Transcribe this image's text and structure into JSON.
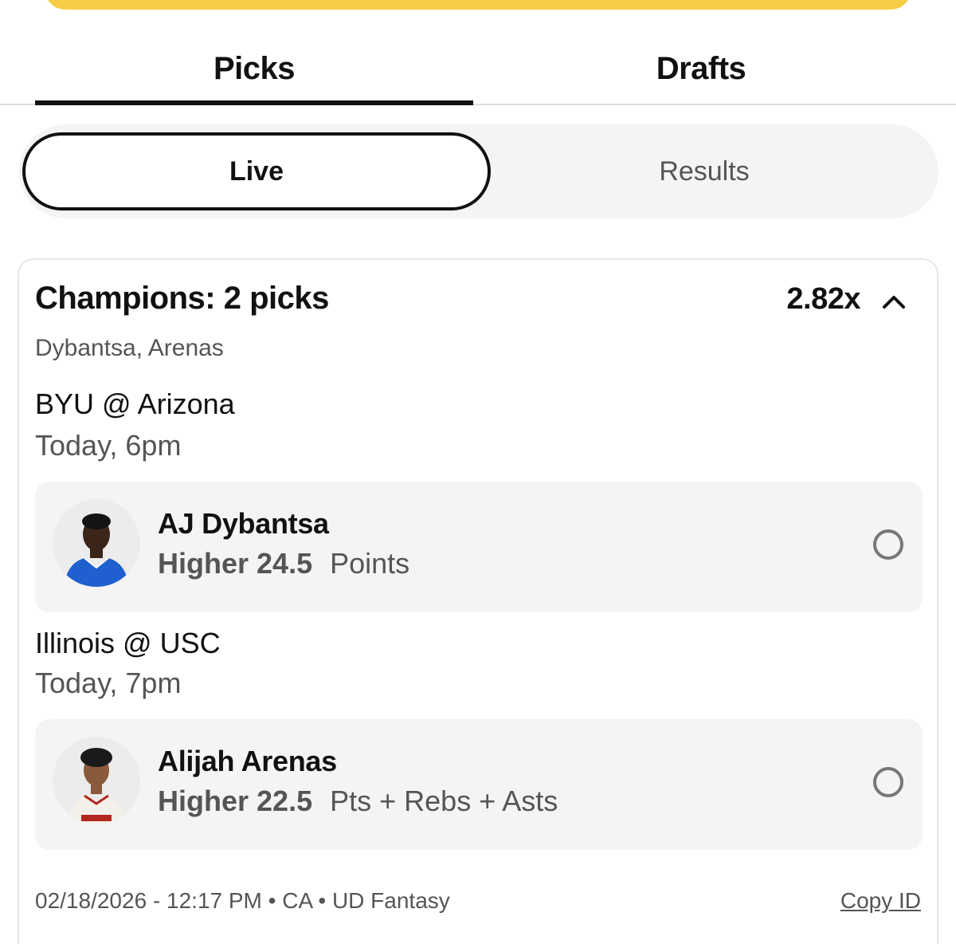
{
  "tabs": {
    "picks": "Picks",
    "drafts": "Drafts"
  },
  "segment": {
    "live": "Live",
    "results": "Results"
  },
  "card": {
    "title": "Champions: 2 picks",
    "multiplier": "2.82x",
    "players_summary": "Dybantsa, Arenas",
    "games": [
      {
        "matchup": "BYU @ Arizona",
        "time": "Today, 6pm",
        "player": "AJ Dybantsa",
        "direction": "Higher",
        "line": "24.5",
        "stat": "Points"
      },
      {
        "matchup": "Illinois @ USC",
        "time": "Today, 7pm",
        "player": "Alijah Arenas",
        "direction": "Higher",
        "line": "22.5",
        "stat": "Pts + Rebs + Asts"
      }
    ],
    "footer": "02/18/2026 - 12:17 PM • CA • UD Fantasy",
    "copy_id": "Copy ID"
  },
  "colors": {
    "accent": "#f7cd45",
    "text": "#111111",
    "muted": "#555555",
    "panel": "#f4f4f4"
  },
  "icons": {
    "collapse": "chevron-up-icon",
    "status": "circle-outline-icon"
  }
}
